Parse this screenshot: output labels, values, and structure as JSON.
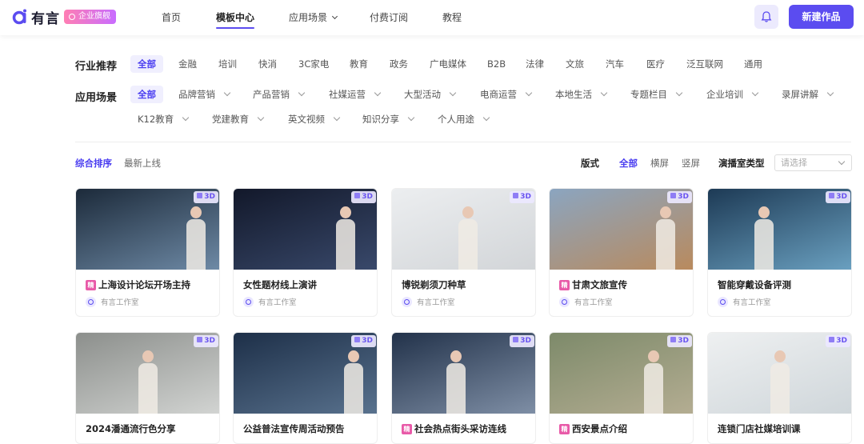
{
  "header": {
    "logo_text": "有言",
    "enterprise_badge": "企业旗舰",
    "nav": [
      {
        "label": "首页"
      },
      {
        "label": "模板中心",
        "active": true
      },
      {
        "label": "应用场景"
      },
      {
        "label": "付费订阅"
      },
      {
        "label": "教程"
      }
    ],
    "new_button": "新建作品",
    "icons": {
      "bell": "bell-icon",
      "chevron": "chevron-down-icon"
    }
  },
  "filters": {
    "industry": {
      "label": "行业推荐",
      "options": [
        "全部",
        "金融",
        "培训",
        "快消",
        "3C家电",
        "教育",
        "政务",
        "广电媒体",
        "B2B",
        "法律",
        "文旅",
        "汽车",
        "医疗",
        "泛互联网",
        "通用"
      ],
      "selected": "全部"
    },
    "scene": {
      "label": "应用场景",
      "options": [
        "全部",
        "品牌营销",
        "产品营销",
        "社媒运营",
        "大型活动",
        "电商运营",
        "本地生活",
        "专题栏目",
        "企业培训",
        "录屏讲解",
        "K12教育",
        "党建教育",
        "英文视频",
        "知识分享",
        "个人用途"
      ],
      "selected": "全部"
    }
  },
  "sort": {
    "options": [
      "综合排序",
      "最新上线"
    ],
    "selected": "综合排序"
  },
  "layout": {
    "label": "版式",
    "options": [
      "全部",
      "横屏",
      "竖屏"
    ],
    "selected": "全部"
  },
  "studio_type": {
    "label": "演播室类型",
    "placeholder": "请选择"
  },
  "badge_3d": "3D",
  "featured_tag": "精",
  "cards": [
    {
      "title": "上海设计论坛开场主持",
      "featured": true,
      "author": "有言工作室",
      "thumb_colors": [
        "#1c2a3a",
        "#6e8aa6"
      ]
    },
    {
      "title": "女性题材线上演讲",
      "featured": false,
      "author": "有言工作室",
      "thumb_colors": [
        "#12182a",
        "#39496b"
      ]
    },
    {
      "title": "博锐剃须刀种草",
      "featured": false,
      "author": "有言工作室",
      "thumb_colors": [
        "#eceef0",
        "#d2d5d8"
      ]
    },
    {
      "title": "甘肃文旅宣传",
      "featured": true,
      "author": "有言工作室",
      "thumb_colors": [
        "#8ba5c0",
        "#b98a5d"
      ]
    },
    {
      "title": "智能穿戴设备评测",
      "featured": false,
      "author": "有言工作室",
      "thumb_colors": [
        "#1d3a55",
        "#6aa0c0"
      ]
    },
    {
      "title": "2024潘通流行色分享",
      "featured": false,
      "author": "有言工作室",
      "thumb_colors": [
        "#8c8f8c",
        "#d2d4d2"
      ]
    },
    {
      "title": "公益普法宣传周活动预告",
      "featured": false,
      "author": "有言工作室",
      "thumb_colors": [
        "#1d2f48",
        "#59728e"
      ]
    },
    {
      "title": "社会热点街头采访连线",
      "featured": true,
      "author": "有言工作室",
      "thumb_colors": [
        "#22324a",
        "#7f8fa6"
      ]
    },
    {
      "title": "西安景点介绍",
      "featured": true,
      "author": "有言工作室",
      "thumb_colors": [
        "#7d8a6a",
        "#b4ad92"
      ]
    },
    {
      "title": "连锁门店社媒培训课",
      "featured": false,
      "author": "有言工作室",
      "thumb_colors": [
        "#eef0f1",
        "#cfd6da"
      ]
    }
  ]
}
